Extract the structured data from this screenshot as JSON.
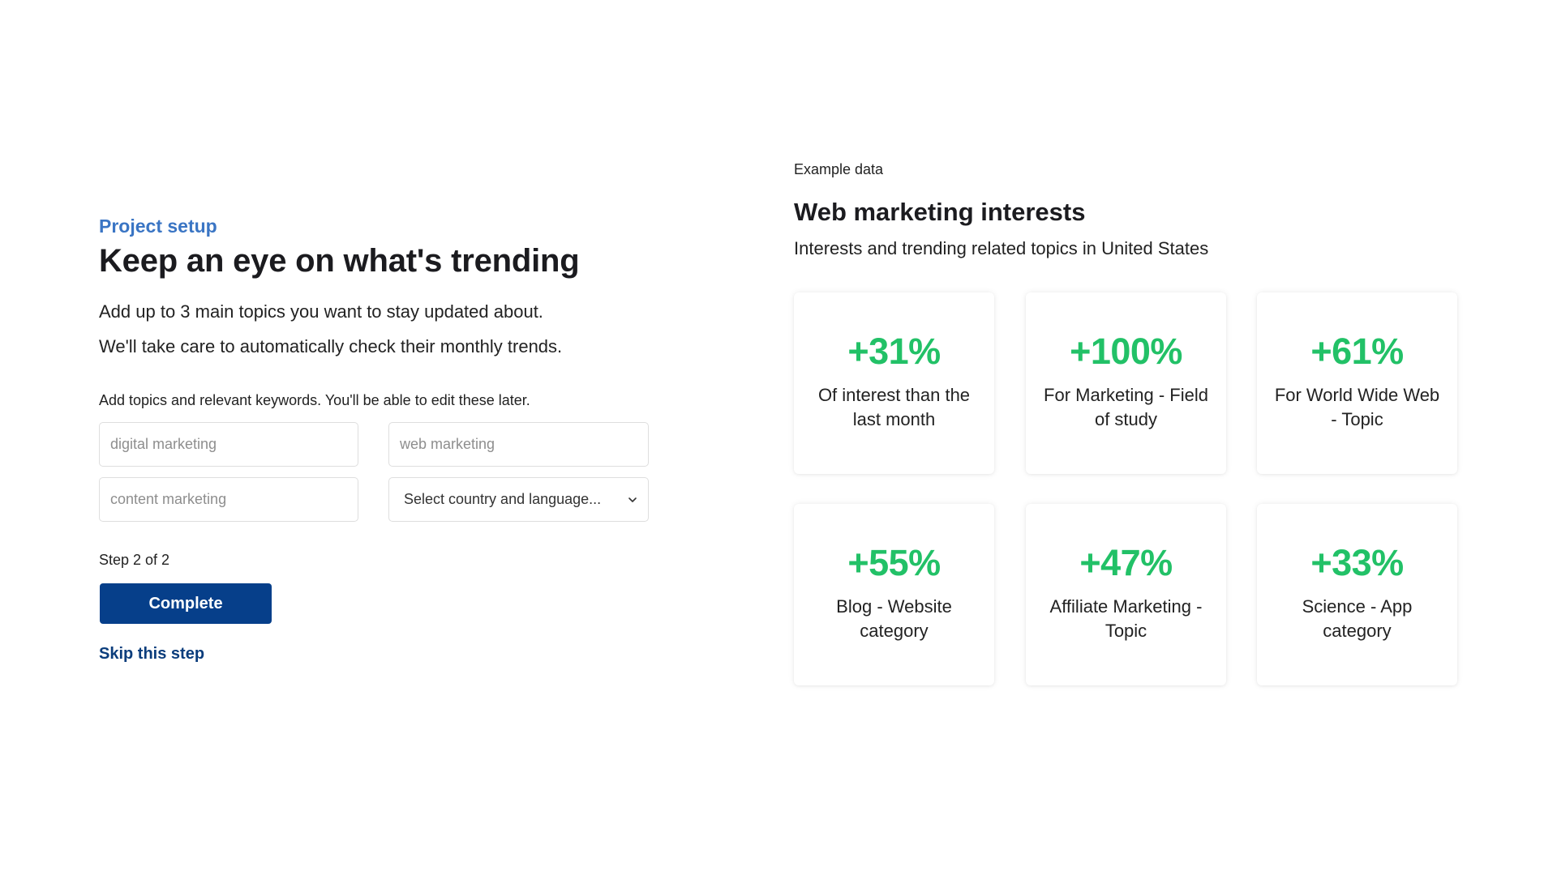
{
  "setup": {
    "eyebrow": "Project setup",
    "title": "Keep an eye on what's trending",
    "description_line1": "Add up to 3 main topics you want to stay updated about.",
    "description_line2": "We'll take care to automatically check their monthly trends.",
    "helper": "Add topics and relevant keywords. You'll be able to edit these later.",
    "inputs": [
      {
        "placeholder": "digital marketing",
        "value": ""
      },
      {
        "placeholder": "web marketing",
        "value": ""
      },
      {
        "placeholder": "content marketing",
        "value": ""
      }
    ],
    "country_select": {
      "selected": "Select country and language..."
    },
    "step": "Step 2 of 2",
    "complete_label": "Complete",
    "skip_label": "Skip this step"
  },
  "example": {
    "eyebrow": "Example data",
    "title": "Web marketing interests",
    "subtitle": "Interests and trending related topics in United States",
    "cards": [
      {
        "value": "+31%",
        "label": "Of interest than the last month"
      },
      {
        "value": "+100%",
        "label": "For Marketing - Field of study"
      },
      {
        "value": "+61%",
        "label": "For World Wide Web - Topic"
      },
      {
        "value": "+55%",
        "label": "Blog - Website category"
      },
      {
        "value": "+47%",
        "label": "Affiliate Marketing - Topic"
      },
      {
        "value": "+33%",
        "label": "Science - App category"
      }
    ]
  },
  "colors": {
    "accent_blue": "#3a75c4",
    "primary_button": "#063f8a",
    "link": "#0b3d7c",
    "trend_green": "#22c167"
  }
}
